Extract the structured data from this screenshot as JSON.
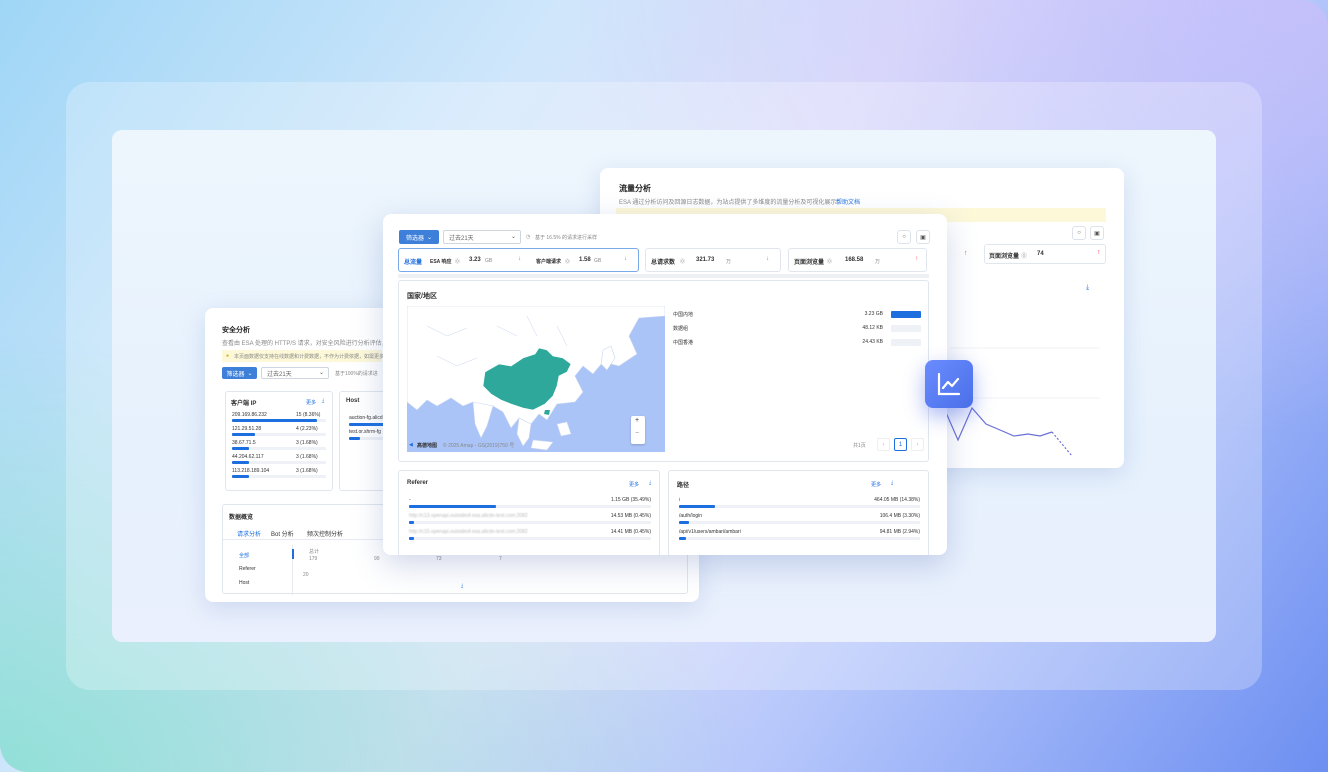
{
  "traffic": {
    "title": "流量分析",
    "desc": "ESA 通过分析访问及回源日志数据，为站点提供了多维度的流量分析及可视化展示。",
    "help_link": "帮助文档",
    "metric_label": "页面浏览量",
    "metric_value": "74"
  },
  "security": {
    "title": "安全分析",
    "desc": "查看由 ESA 处理的 HTTP/S 请求，对安全风险进行分析评估，同时",
    "notice": "本页面数据仅支持在线数据和计费数据，不作为计费依据，如需更多数据",
    "filter_label": "筛选器",
    "time_range": "过去21天",
    "sample_note": "基于100%的请求进",
    "client_ip_title": "客户端 IP",
    "more": "更多",
    "host_title": "Host",
    "ip_rows": [
      {
        "ip": "209.169.86.232",
        "val": "15 (8.36%)",
        "pct": 0.9
      },
      {
        "ip": "121.29.51.28",
        "val": "4 (2.23%)",
        "pct": 0.24
      },
      {
        "ip": "38.67.71.5",
        "val": "3 (1.68%)",
        "pct": 0.18
      },
      {
        "ip": "44.204.62.117",
        "val": "3 (1.68%)",
        "pct": 0.18
      },
      {
        "ip": "113.218.189.104",
        "val": "3 (1.68%)",
        "pct": 0.18
      }
    ],
    "host_rows": [
      "auction-fg.alicd",
      "test.or.shrm-fg"
    ],
    "overview_title": "数据概览",
    "tabs": [
      "请求分析",
      "Bot 分析",
      "频次控制分析"
    ],
    "side_items": [
      "全部",
      "Referer",
      "Host"
    ],
    "sum_label": "总计",
    "sum_value": "179",
    "col_values": [
      "99",
      "73",
      "7"
    ],
    "axis_tick": "20"
  },
  "main": {
    "filter_label": "筛选器",
    "time_range": "过去21天",
    "sample_note": "基于 16.5% 的请求进行采样",
    "total_traffic_label": "总流量",
    "esa_resp_label": "ESA 响应",
    "esa_resp_value": "3.23",
    "esa_resp_unit": "GB",
    "client_req_label": "客户端请求",
    "client_req_value": "1.58",
    "client_req_unit": "GB",
    "total_req_label": "总请求数",
    "total_req_value": "321.73",
    "total_req_unit": "万",
    "pv_label": "页面浏览量",
    "pv_value": "168.58",
    "pv_unit": "万",
    "region_title": "国家/地区",
    "regions": [
      {
        "name": "中国内地",
        "value": "3.23 GB",
        "pct": 1.0
      },
      {
        "name": "数据组",
        "value": "48.12 KB",
        "pct": 0.0
      },
      {
        "name": "中国香港",
        "value": "24.43 KB",
        "pct": 0.0
      }
    ],
    "map_credit": "© 2025 Amap - GS(2019)750 号",
    "map_logo": "高德地图",
    "zoom_in": "+",
    "zoom_out": "−",
    "pagination_total": "共1页",
    "page_current": "1",
    "referer_title": "Referer",
    "path_title": "路径",
    "more": "更多",
    "referer_rows": [
      {
        "name": "-",
        "value": "1.15 GB (35.49%)",
        "pct": 0.36
      },
      {
        "name": "http://c13.openapi.outsideof-esa.alicdn-test.com:2082",
        "value": "14.53 MB (0.45%)",
        "pct": 0.02
      },
      {
        "name": "http://c15.openapi.outsideof-esa.alicdn-test.com:2082",
        "value": "14.41 MB (0.45%)",
        "pct": 0.02
      }
    ],
    "path_rows": [
      {
        "name": "/",
        "value": "464.05 MB (14.38%)",
        "pct": 0.15
      },
      {
        "name": "/auth/login",
        "value": "106.4 MB (3.30%)",
        "pct": 0.04
      },
      {
        "name": "/api/v1/users/ambari/ambari",
        "value": "94.81 MB (2.94%)",
        "pct": 0.03
      }
    ]
  },
  "colors": {
    "accent": "#1d6fe0",
    "china": "#2fa89c",
    "water": "#aac4f7",
    "land": "#ffffff"
  }
}
